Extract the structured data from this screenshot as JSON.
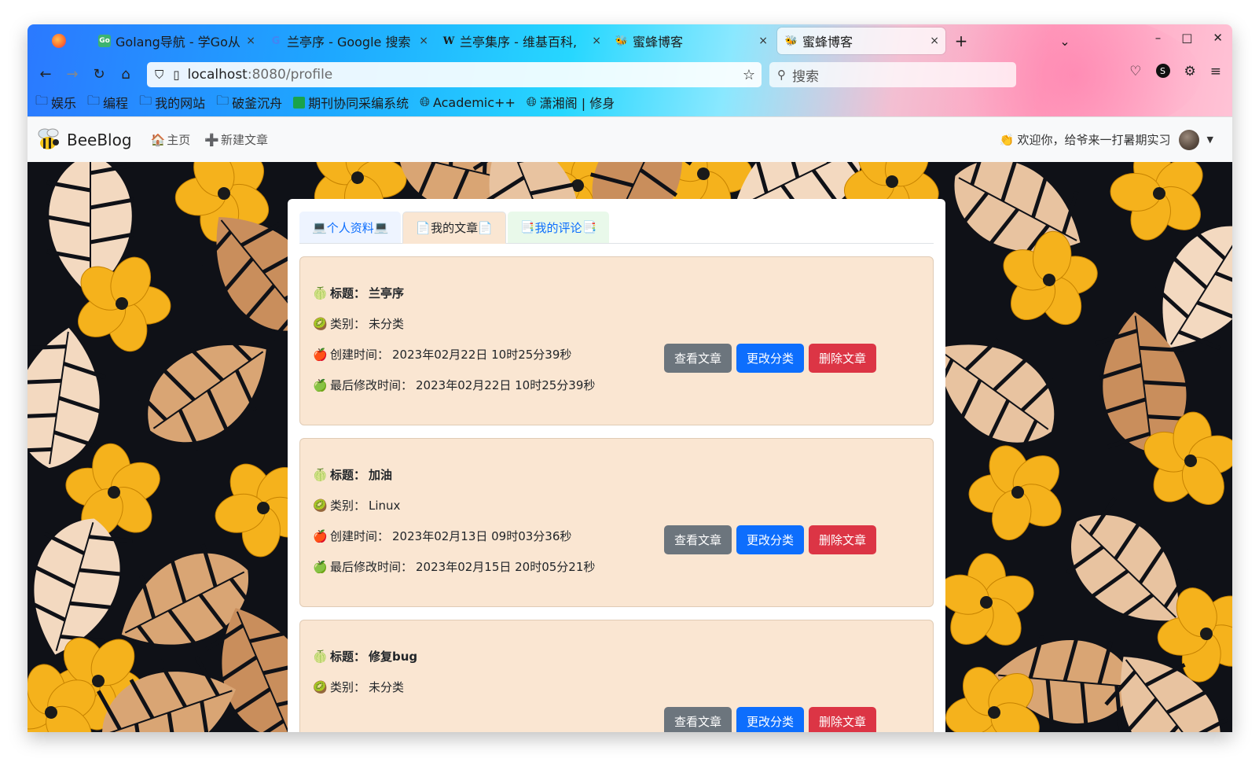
{
  "browser": {
    "tabs": [
      {
        "label": "Golang导航 - 学Go从",
        "icon": "go-icon",
        "active": false
      },
      {
        "label": "兰亭序 - Google 搜索",
        "icon": "google-icon",
        "active": false
      },
      {
        "label": "兰亭集序 - 维基百科,",
        "icon": "wikipedia-icon",
        "active": false
      },
      {
        "label": "蜜蜂博客",
        "icon": "bee-icon",
        "active": false
      },
      {
        "label": "蜜蜂博客",
        "icon": "bee-icon",
        "active": true
      }
    ],
    "url": {
      "host": "localhost",
      "rest": ":8080/profile"
    },
    "search_placeholder": "搜索",
    "bookmarks": [
      {
        "label": "娱乐",
        "icon": "folder-icon"
      },
      {
        "label": "编程",
        "icon": "folder-icon"
      },
      {
        "label": "我的网站",
        "icon": "folder-icon"
      },
      {
        "label": "破釜沉舟",
        "icon": "folder-icon"
      },
      {
        "label": "期刊协同采编系统",
        "icon": "journal-icon"
      },
      {
        "label": "Academic++",
        "icon": "globe-icon"
      },
      {
        "label": "潇湘阁 | 修身",
        "icon": "globe-icon"
      }
    ]
  },
  "navbar": {
    "brand": "BeeBlog",
    "links": [
      {
        "label": "主页",
        "icon": "house-icon"
      },
      {
        "label": "新建文章",
        "icon": "plus-icon"
      }
    ],
    "welcome": "欢迎你，给爷来一打暑期实习"
  },
  "profile_tabs": [
    {
      "label": "个人资料",
      "icon": "laptop-icon"
    },
    {
      "label": "我的文章",
      "icon": "page-icon"
    },
    {
      "label": "我的评论",
      "icon": "bookmark-tabs-icon"
    }
  ],
  "field_labels": {
    "title": "标题：",
    "category": "类别：",
    "created": "创建时间：",
    "modified": "最后修改时间："
  },
  "buttons": {
    "view": "查看文章",
    "change": "更改分类",
    "delete": "删除文章"
  },
  "articles": [
    {
      "title": "兰亭序",
      "category": "未分类",
      "created": "2023年02月22日 10时25分39秒",
      "modified": "2023年02月22日 10时25分39秒"
    },
    {
      "title": "加油",
      "category": "Linux",
      "created": "2023年02月13日 09时03分36秒",
      "modified": "2023年02月15日 20时05分21秒"
    },
    {
      "title": "修复bug",
      "category": "未分类"
    }
  ],
  "colors": {
    "card_bg": "#fae6d2",
    "primary": "#0d6efd",
    "danger": "#dc3545",
    "secondary": "#6c757d"
  }
}
